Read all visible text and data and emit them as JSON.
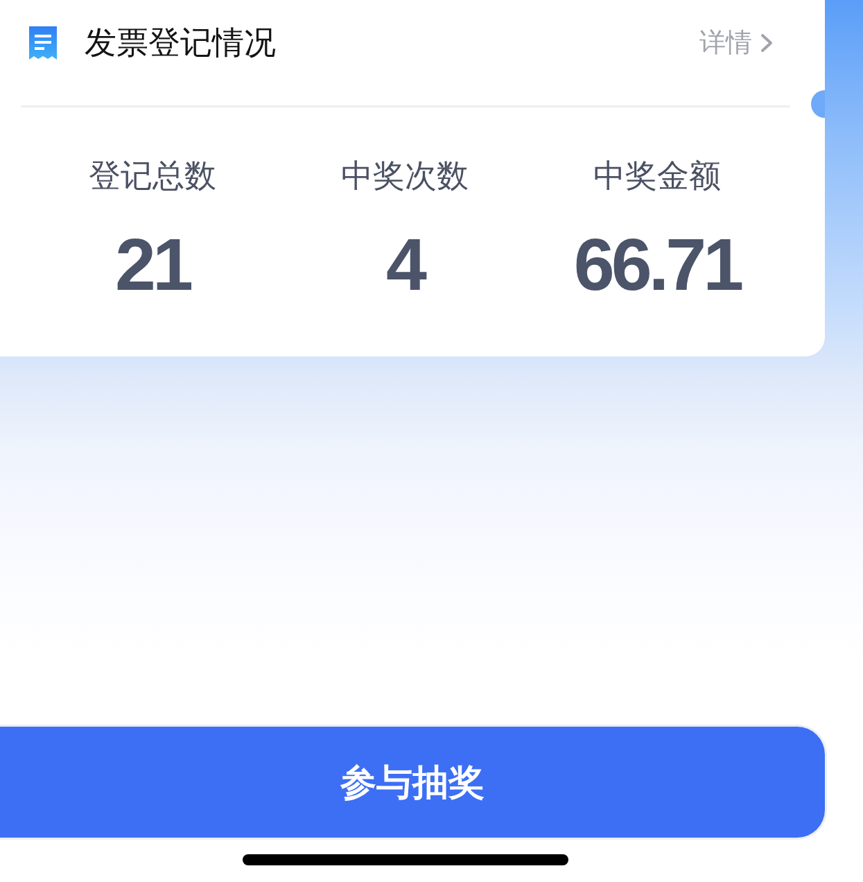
{
  "header": {
    "title": "发票登记情况",
    "link": "详情"
  },
  "stats": [
    {
      "label": "登记总数",
      "value": "21"
    },
    {
      "label": "中奖次数",
      "value": "4"
    },
    {
      "label": "中奖金额",
      "value": "66.71"
    }
  ],
  "action_button": {
    "label": "参与抽奖"
  }
}
